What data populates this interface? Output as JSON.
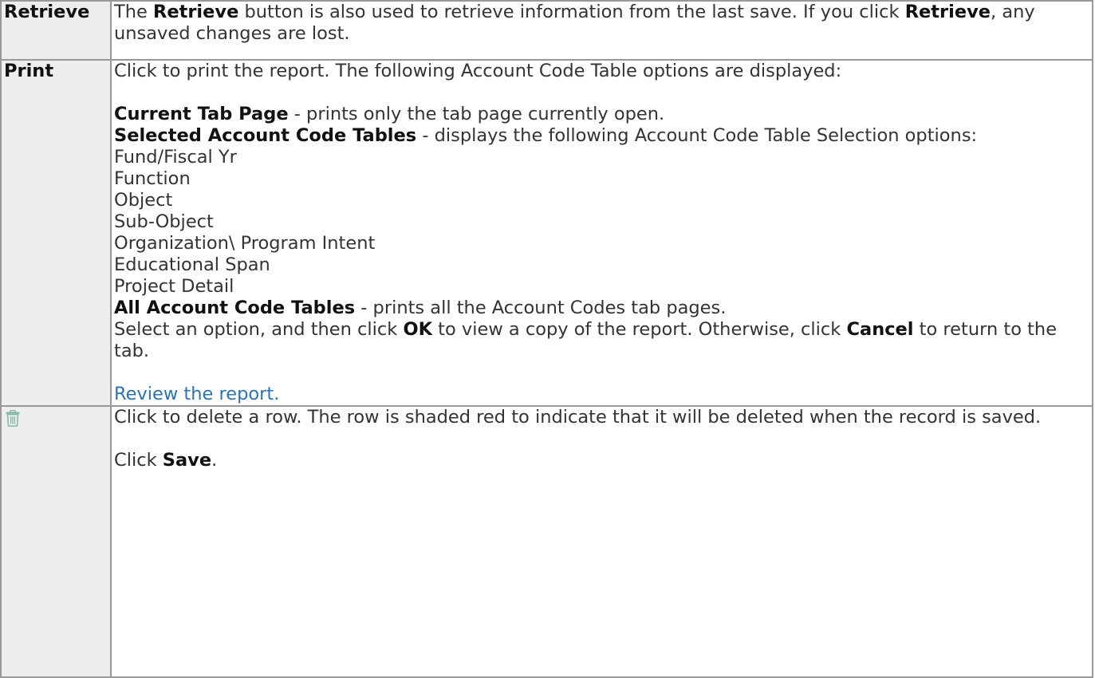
{
  "rows": {
    "retrieve": {
      "label": "Retrieve",
      "t1": "The ",
      "b1": "Retrieve",
      "t2": " button is also used to retrieve information from the last save. If you click ",
      "b2": "Retrieve",
      "t3": ", any unsaved changes are lost."
    },
    "print": {
      "label": "Print",
      "intro": "Click to print the report. The following Account Code Table options are displayed:",
      "opt1_b": "Current Tab Page",
      "opt1_t": " - prints only the tab page currently open.",
      "opt2_b": "Selected Account Code Tables",
      "opt2_t": " - displays the following Account Code Table Selection options:",
      "tables": [
        "Fund/Fiscal Yr",
        "Function",
        "Object",
        "Sub-Object",
        "Organization\\ Program Intent",
        "Educational Span",
        "Project Detail"
      ],
      "opt3_b": "All Account Code Tables",
      "opt3_t": " - prints all the Account Codes tab pages.",
      "sel_t1": "Select an option, and then click ",
      "sel_b1": "OK",
      "sel_t2": " to view a copy of the report. Otherwise, click ",
      "sel_b2": "Cancel",
      "sel_t3": " to return to the tab.",
      "link": "Review the report."
    },
    "delete": {
      "icon": "trash-icon",
      "line1": "Click to delete a row. The row is shaded red to indicate that it will be deleted when the record is saved.",
      "save_t": "Click ",
      "save_b": "Save",
      "save_end": "."
    }
  },
  "colors": {
    "link": "#2b73b7",
    "border": "#999999",
    "label_bg": "#eeeeee",
    "icon": "#7fb9a0"
  }
}
